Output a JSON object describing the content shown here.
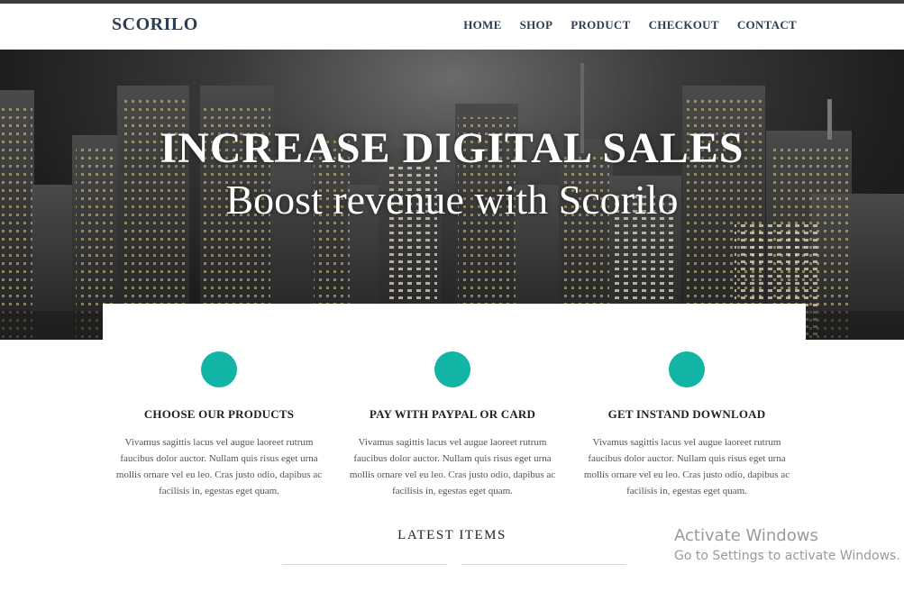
{
  "brand": "SCORILO",
  "nav": [
    "HOME",
    "SHOP",
    "PRODUCT",
    "CHECKOUT",
    "CONTACT"
  ],
  "hero": {
    "title": "INCREASE DIGITAL SALES",
    "subtitle": "Boost revenue with Scorilo"
  },
  "features": [
    {
      "title": "CHOOSE OUR PRODUCTS",
      "text": "Vivamus sagittis lacus vel augue laoreet rutrum faucibus dolor auctor. Nullam quis risus eget urna mollis ornare vel eu leo. Cras justo odio, dapibus ac facilisis in, egestas eget quam."
    },
    {
      "title": "PAY WITH PAYPAL OR CARD",
      "text": "Vivamus sagittis lacus vel augue laoreet rutrum faucibus dolor auctor. Nullam quis risus eget urna mollis ornare vel eu leo. Cras justo odio, dapibus ac facilisis in, egestas eget quam."
    },
    {
      "title": "GET INSTAND DOWNLOAD",
      "text": "Vivamus sagittis lacus vel augue laoreet rutrum faucibus dolor auctor. Nullam quis risus eget urna mollis ornare vel eu leo. Cras justo odio, dapibus ac facilisis in, egestas eget quam."
    }
  ],
  "latest_heading": "LATEST ITEMS",
  "watermark": {
    "line1": "Activate Windows",
    "line2": "Go to Settings to activate Windows."
  },
  "colors": {
    "accent": "#12b5a5",
    "brand_text": "#2c3e50"
  }
}
